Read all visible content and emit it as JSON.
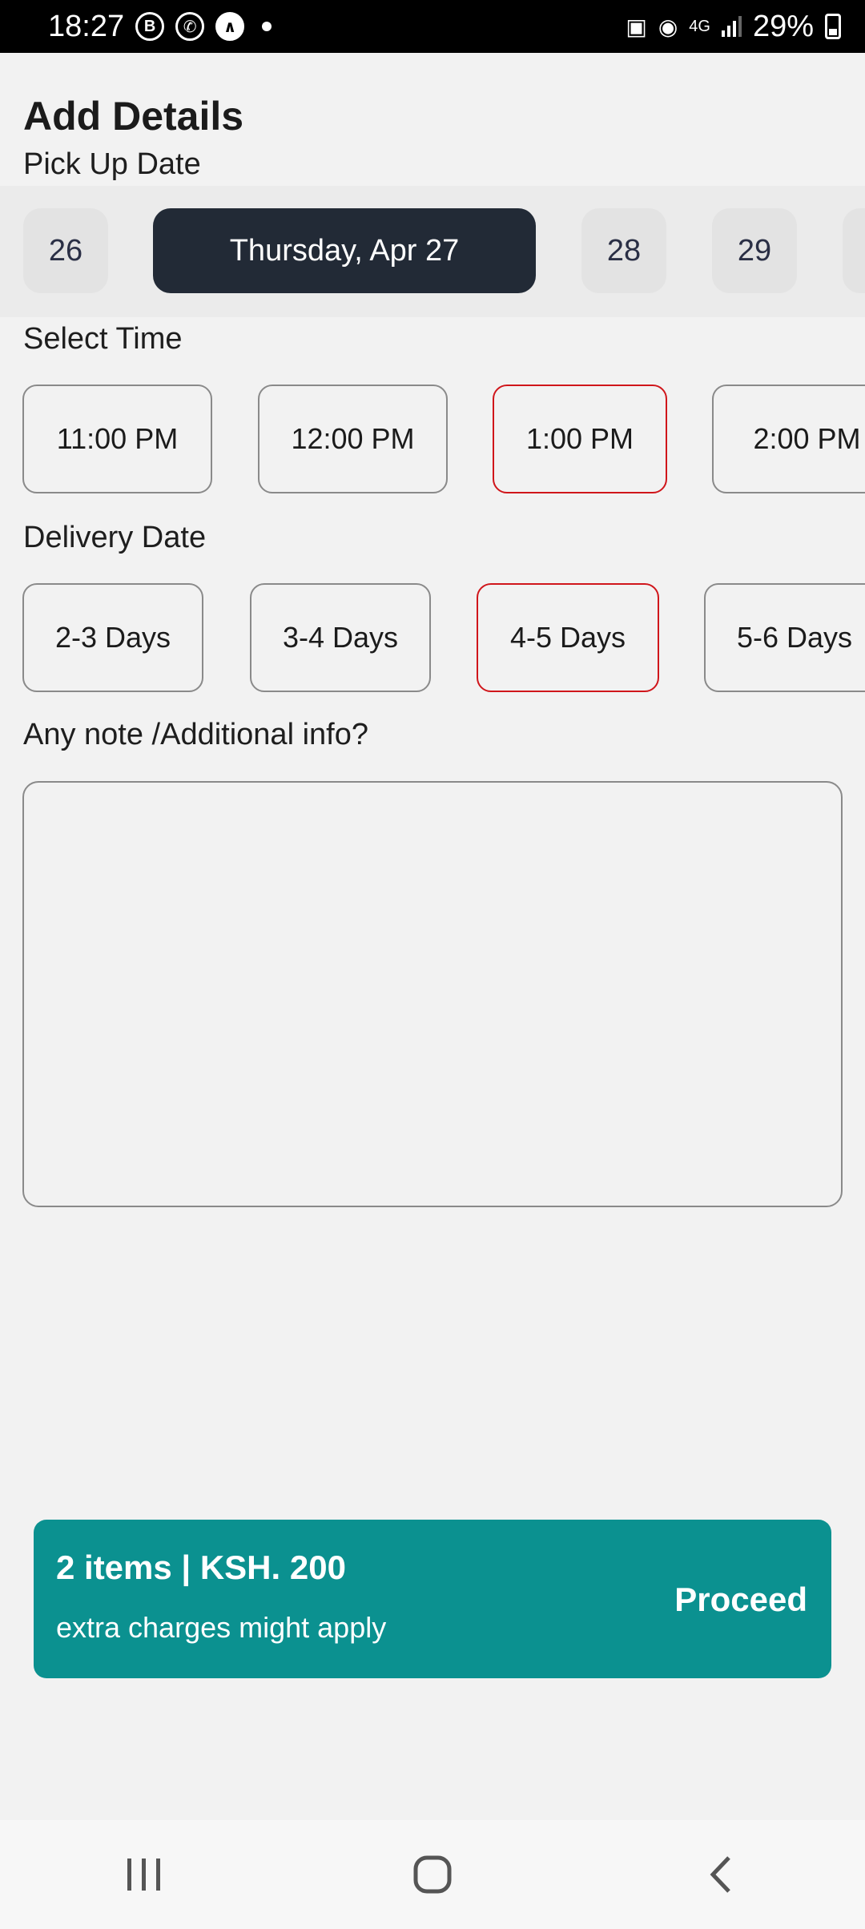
{
  "status_bar": {
    "time": "18:27",
    "notif_icons": [
      "B",
      "whatsapp",
      "^"
    ],
    "network": "4G",
    "battery": "29%"
  },
  "page": {
    "title": "Add Details",
    "pickup_label": "Pick Up Date",
    "time_label": "Select Time",
    "delivery_label": "Delivery Date",
    "note_label": "Any note /Additional info?",
    "note_value": ""
  },
  "pickup_dates": [
    {
      "label": "26",
      "selected": false
    },
    {
      "label": "Thursday, Apr 27",
      "selected": true
    },
    {
      "label": "28",
      "selected": false
    },
    {
      "label": "29",
      "selected": false
    },
    {
      "label": "",
      "selected": false
    }
  ],
  "times": [
    {
      "label": "11:00 PM",
      "selected": false
    },
    {
      "label": "12:00 PM",
      "selected": false
    },
    {
      "label": "1:00 PM",
      "selected": true
    },
    {
      "label": "2:00 PM",
      "selected": false
    }
  ],
  "delivery_options": [
    {
      "label": "2-3 Days",
      "selected": false
    },
    {
      "label": "3-4 Days",
      "selected": false
    },
    {
      "label": "4-5 Days",
      "selected": true
    },
    {
      "label": "5-6 Days",
      "selected": false
    }
  ],
  "cart": {
    "summary": "2 items | KSH. 200",
    "note": "extra charges might apply",
    "action": "Proceed"
  },
  "colors": {
    "accent": "#0b9190",
    "selected_border": "#d0161b",
    "selected_date": "#222a36"
  }
}
